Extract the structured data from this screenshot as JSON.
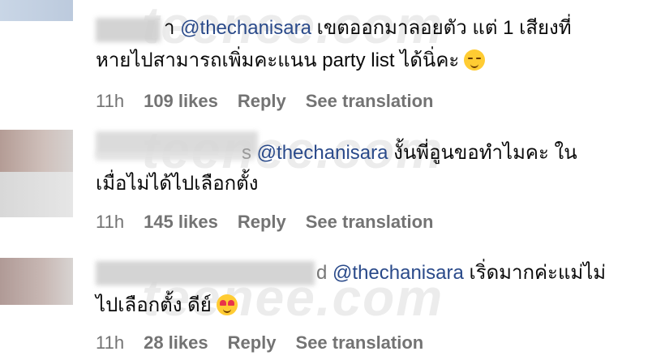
{
  "watermark": "teenee.com",
  "comments": [
    {
      "name_tail": "า",
      "mention": "@thechanisara",
      "line1_rest": " เขตออกมาลอยตัว แต่ 1 เสียงที่",
      "line2": "หายไปสามารถเพิ่มคะแนน party list ได้นิ่คะ",
      "emoji": "woozy-face-emoji",
      "time": "11h",
      "likes": "109 likes",
      "reply": "Reply",
      "translate": "See translation"
    },
    {
      "name_tail": "s",
      "mention": "@thechanisara",
      "line1_rest": " งั้นพี่อูนขอทำไมคะ ใน",
      "line2": "เมื่อไม่ได้ไปเลือกตั้ง",
      "emoji": "",
      "time": "11h",
      "likes": "145 likes",
      "reply": "Reply",
      "translate": "See translation"
    },
    {
      "name_tail": "d",
      "mention": "@thechanisara",
      "line1_rest": " เริ่ดมากค่ะแม่ไม่",
      "line2": "ไปเลือกตั้ง ดีย์",
      "emoji": "heart-eyes-emoji",
      "time": "11h",
      "likes": "28 likes",
      "reply": "Reply",
      "translate": "See translation"
    }
  ]
}
